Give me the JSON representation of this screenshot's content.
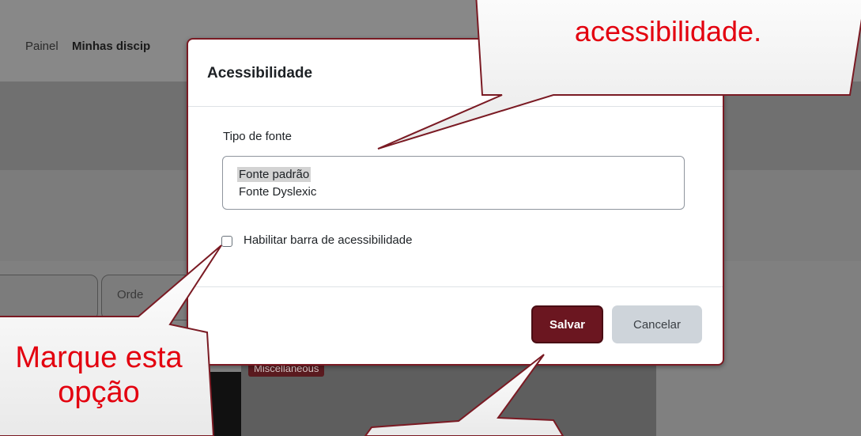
{
  "background": {
    "nav": {
      "painel": "Painel",
      "minhas": "Minhas discip"
    },
    "filter_partial": "Orde",
    "course_badge": "Miscellaneous"
  },
  "modal": {
    "title": "Acessibilidade",
    "font_field": {
      "label": "Tipo de fonte",
      "options": [
        "Fonte padrão",
        "Fonte Dyslexic"
      ],
      "selected": "Fonte padrão"
    },
    "checkbox": {
      "label": "Habilitar barra de acessibilidade",
      "checked": false
    },
    "buttons": {
      "save": "Salvar",
      "cancel": "Cancelar"
    }
  },
  "callouts": {
    "top": "acessibilidade.",
    "left_line1": "Marque esta",
    "left_line2": "opção"
  },
  "colors": {
    "accent": "#6b1620",
    "callout_text": "#e3000f",
    "callout_border": "#7a1a23"
  }
}
